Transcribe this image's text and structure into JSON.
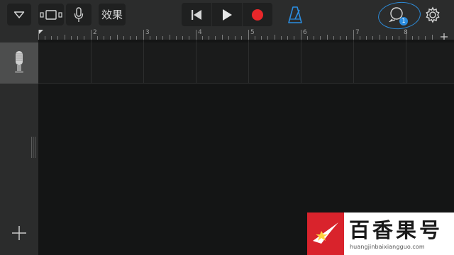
{
  "toolbar": {
    "menu_icon": "triangle-down-icon",
    "view_toggle_icon": "track-view-icon",
    "mic_icon": "microphone-icon",
    "fx_label": "效果",
    "rewind_icon": "rewind-icon",
    "play_icon": "play-icon",
    "record_icon": "record-icon",
    "metronome_icon": "metronome-icon",
    "loop_icon": "loop-browser-icon",
    "loop_badge": "1",
    "settings_icon": "gear-icon"
  },
  "ruler": {
    "bar_numbers": [
      "2",
      "3",
      "4",
      "5",
      "6",
      "7",
      "8"
    ],
    "add_section_icon": "plus-icon"
  },
  "tracks": [
    {
      "instrument_icon": "microphone-icon"
    }
  ],
  "sidebar": {
    "add_track_icon": "plus-icon",
    "resize_handle_icon": "grip-handle-icon"
  },
  "watermark": {
    "title": "百香果号",
    "url": "huangjinbaixiangguo.com"
  },
  "colors": {
    "toolbar_bg": "#2b2c2c",
    "button_bg": "#1f2020",
    "record": "#e8272a",
    "accent_blue": "#2b8de0",
    "track_header_bg": "#4d4e4e",
    "watermark_red": "#d9232c"
  }
}
